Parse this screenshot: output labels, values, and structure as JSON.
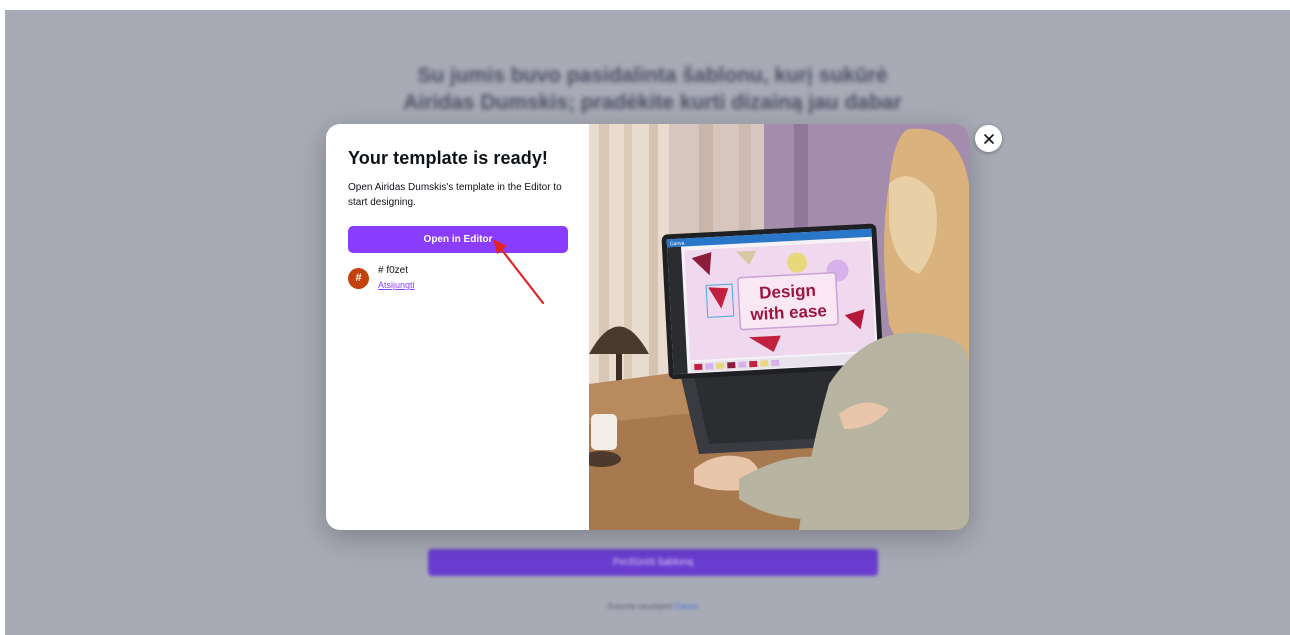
{
  "background": {
    "heading": "Su jumis buvo pasidalinta šablonu, kurį sukūrė Airidas Dumskis; pradėkite kurti dizainą jau dabar",
    "button_label": "Peržiūrėti šabloną",
    "footer_text": "Sukurta naudojant",
    "footer_link": "Canva"
  },
  "modal": {
    "title": "Your template is ready!",
    "description": "Open Airidas Dumskis's template in the Editor to start designing.",
    "open_button_label": "Open in Editor",
    "user": {
      "avatar_initial": "#",
      "name": "# f0zet",
      "link_label": "Atsijungti"
    },
    "image": {
      "laptop_brand": "Canva",
      "laptop_headline_line1": "Design",
      "laptop_headline_line2": "with ease"
    }
  },
  "colors": {
    "accent": "#8b3dff",
    "backdrop": "#a8abb6",
    "avatar": "#c2410c",
    "annotation_arrow": "#e02424"
  },
  "icons": {
    "close": "close-icon",
    "annotation": "red-arrow-icon"
  }
}
